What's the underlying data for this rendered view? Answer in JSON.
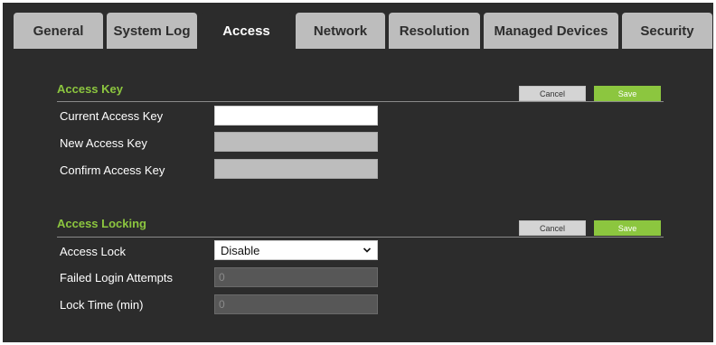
{
  "tabs": [
    {
      "label": "General",
      "active": false
    },
    {
      "label": "System Log",
      "active": false
    },
    {
      "label": "Access",
      "active": true
    },
    {
      "label": "Network",
      "active": false
    },
    {
      "label": "Resolution",
      "active": false
    },
    {
      "label": "Managed Devices",
      "active": false
    },
    {
      "label": "Security",
      "active": false
    }
  ],
  "access_key": {
    "title": "Access Key",
    "cancel_label": "Cancel",
    "save_label": "Save",
    "current_label": "Current Access Key",
    "current_value": "",
    "new_label": "New Access Key",
    "new_value": "",
    "confirm_label": "Confirm Access Key",
    "confirm_value": ""
  },
  "access_locking": {
    "title": "Access Locking",
    "cancel_label": "Cancel",
    "save_label": "Save",
    "lock_label": "Access Lock",
    "lock_value": "Disable",
    "attempts_label": "Failed Login Attempts",
    "attempts_value": "0",
    "time_label": "Lock Time (min)",
    "time_value": "0"
  },
  "colors": {
    "accent": "#8cc63f",
    "panel": "#2c2c2c",
    "tab_inactive": "#bdbdbd"
  }
}
